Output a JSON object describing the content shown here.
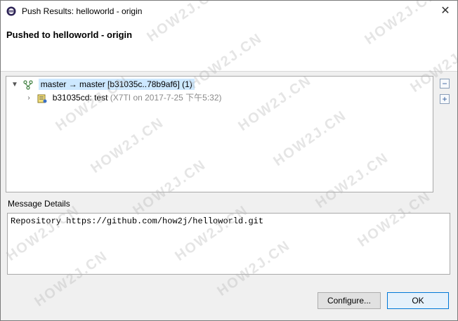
{
  "window": {
    "title": "Push Results: helloworld - origin",
    "close_glyph": "✕"
  },
  "header": {
    "title": "Pushed to helloworld - origin"
  },
  "tree": {
    "ref_update": {
      "label": "master → master [b31035c..78b9af6] (1)",
      "icon": "branch-icon"
    },
    "commit": {
      "label": "b31035cd: test",
      "author": "(X7TI on 2017-7-25 下午5:32)",
      "icon": "commit-icon"
    }
  },
  "side_buttons": {
    "collapse_glyph": "−",
    "expand_glyph": "+"
  },
  "message": {
    "label": "Message Details",
    "text": "Repository https://github.com/how2j/helloworld.git"
  },
  "buttons": {
    "configure": "Configure...",
    "ok": "OK"
  },
  "watermark": "HOW2J.CN",
  "colors": {
    "selection": "#cde8ff",
    "default_button_border": "#0078d7"
  }
}
